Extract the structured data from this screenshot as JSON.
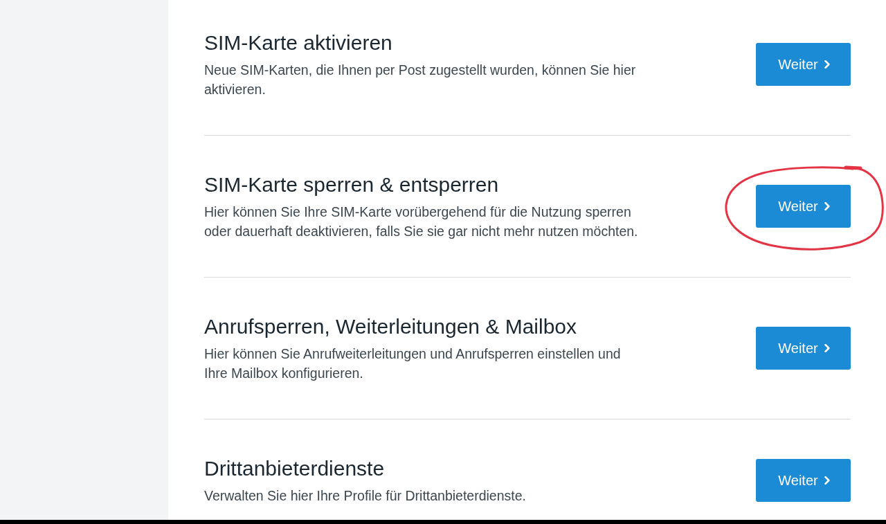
{
  "sections": [
    {
      "title": "SIM-Karte aktivieren",
      "description": "Neue SIM-Karten, die Ihnen per Post zugestellt wurden, können Sie hier aktivieren.",
      "button": {
        "label": "Weiter"
      },
      "annotated": false
    },
    {
      "title": "SIM-Karte sperren & entsperren",
      "description": "Hier können Sie Ihre SIM-Karte vorübergehend für die Nutzung sperren oder dauerhaft deaktivieren, falls Sie sie gar nicht mehr nutzen möchten.",
      "button": {
        "label": "Weiter"
      },
      "annotated": true
    },
    {
      "title": "Anrufsperren, Weiterleitungen & Mailbox",
      "description": "Hier können Sie Anrufweiterleitungen und Anrufsperren einstellen und Ihre Mailbox konfigurieren.",
      "button": {
        "label": "Weiter"
      },
      "annotated": false
    },
    {
      "title": "Drittanbieterdienste",
      "description": "Verwalten Sie hier Ihre Profile für Drittanbieterdienste.",
      "button": {
        "label": "Weiter"
      },
      "annotated": false
    }
  ]
}
